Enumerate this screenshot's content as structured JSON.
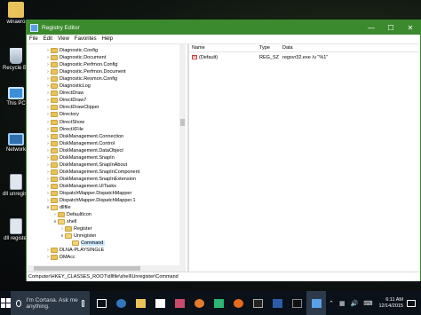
{
  "desktop": {
    "icons": [
      {
        "label": "winaero"
      },
      {
        "label": "Recycle Bin"
      },
      {
        "label": "This PC"
      },
      {
        "label": "Network"
      },
      {
        "label": "dll unregister"
      },
      {
        "label": "dll register"
      }
    ]
  },
  "window": {
    "title": "Registry Editor",
    "menu": [
      "File",
      "Edit",
      "View",
      "Favorites",
      "Help"
    ],
    "tree": [
      {
        "label": "Diagnostic.Config",
        "depth": 1
      },
      {
        "label": "Diagnostic.Document",
        "depth": 1
      },
      {
        "label": "Diagnostic.Perfmon.Config",
        "depth": 1
      },
      {
        "label": "Diagnostic.Perfmon.Document",
        "depth": 1
      },
      {
        "label": "Diagnostic.Resmon.Config",
        "depth": 1
      },
      {
        "label": "DiagnosticLog",
        "depth": 1
      },
      {
        "label": "DirectDraw",
        "depth": 1
      },
      {
        "label": "DirectDraw7",
        "depth": 1
      },
      {
        "label": "DirectDrawClipper",
        "depth": 1
      },
      {
        "label": "Directory",
        "depth": 1
      },
      {
        "label": "DirectShow",
        "depth": 1
      },
      {
        "label": "DirectXFile",
        "depth": 1
      },
      {
        "label": "DiskManagement.Connection",
        "depth": 1
      },
      {
        "label": "DiskManagement.Control",
        "depth": 1
      },
      {
        "label": "DiskManagement.DataObject",
        "depth": 1
      },
      {
        "label": "DiskManagement.SnapIn",
        "depth": 1
      },
      {
        "label": "DiskManagement.SnapInAbout",
        "depth": 1
      },
      {
        "label": "DiskManagement.SnapInComponent",
        "depth": 1
      },
      {
        "label": "DiskManagement.SnapInExtension",
        "depth": 1
      },
      {
        "label": "DiskManagement.UITasks",
        "depth": 1
      },
      {
        "label": "DispatchMapper.DispatchMapper",
        "depth": 1
      },
      {
        "label": "DispatchMapper.DispatchMapper.1",
        "depth": 1
      },
      {
        "label": "dllfile",
        "depth": 1,
        "expanded": true
      },
      {
        "label": "DefaultIcon",
        "depth": 2
      },
      {
        "label": "shell",
        "depth": 2,
        "expanded": true
      },
      {
        "label": "Register",
        "depth": 3
      },
      {
        "label": "Unregister",
        "depth": 3,
        "expanded": true
      },
      {
        "label": "Command",
        "depth": 4,
        "selected": true
      },
      {
        "label": "DLNA-PLAYSINGLE",
        "depth": 1
      },
      {
        "label": "DMAcc",
        "depth": 1
      }
    ],
    "columns": {
      "name": "Name",
      "type": "Type",
      "data": "Data"
    },
    "values": [
      {
        "name": "(Default)",
        "type": "REG_SZ",
        "data": "regsvr32.exe /u \"%1\""
      }
    ],
    "status_path": "Computer\\HKEY_CLASSES_ROOT\\dllfile\\shell\\Unregister\\Command"
  },
  "taskbar": {
    "search_placeholder": "I'm Cortana. Ask me anything.",
    "time": "6:11 AM",
    "date": "12/14/2015"
  }
}
